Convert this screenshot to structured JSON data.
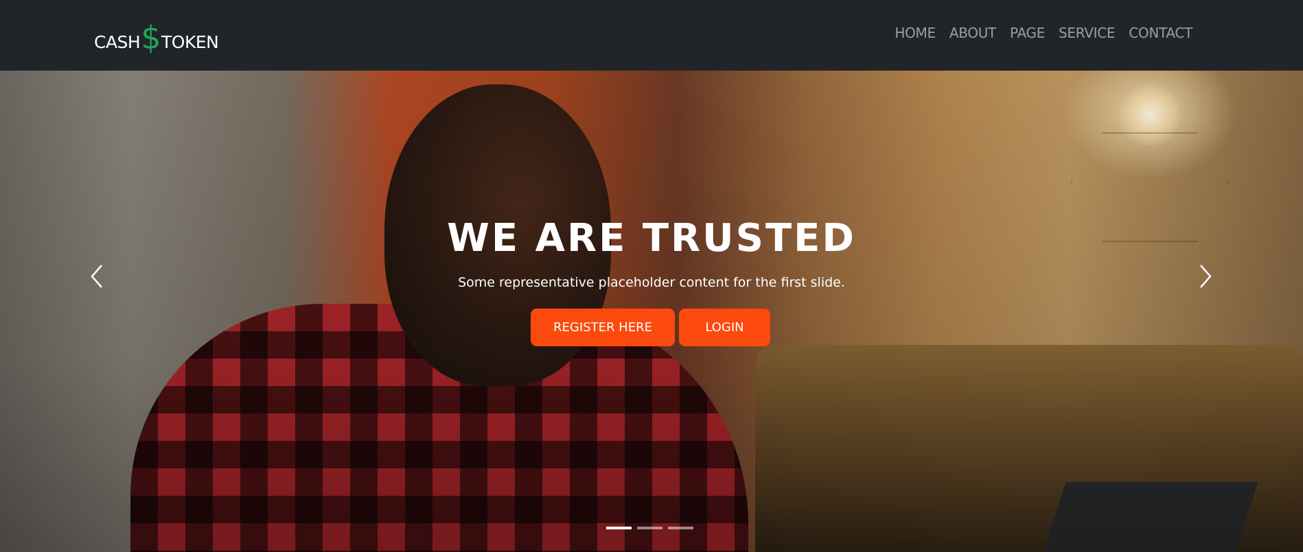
{
  "brand": {
    "left": "CASH",
    "symbol": "$",
    "right": "TOKEN",
    "symbol_color": "#23a55a"
  },
  "nav": {
    "items": [
      {
        "label": "HOME"
      },
      {
        "label": "ABOUT"
      },
      {
        "label": "PAGE"
      },
      {
        "label": "SERVICE"
      },
      {
        "label": "CONTACT"
      }
    ]
  },
  "hero": {
    "title": "WE ARE TRUSTED",
    "subtitle": "Some representative placeholder content for the first slide.",
    "register_label": "REGISTER HERE",
    "login_label": "LOGIN",
    "button_color": "#fc4a0e",
    "prev_icon": "chevron-left-icon",
    "next_icon": "chevron-right-icon",
    "slide_count": 3,
    "active_slide": 1
  },
  "colors": {
    "navbar_bg": "#212529",
    "nav_link": "rgba(255,255,255,0.55)"
  }
}
